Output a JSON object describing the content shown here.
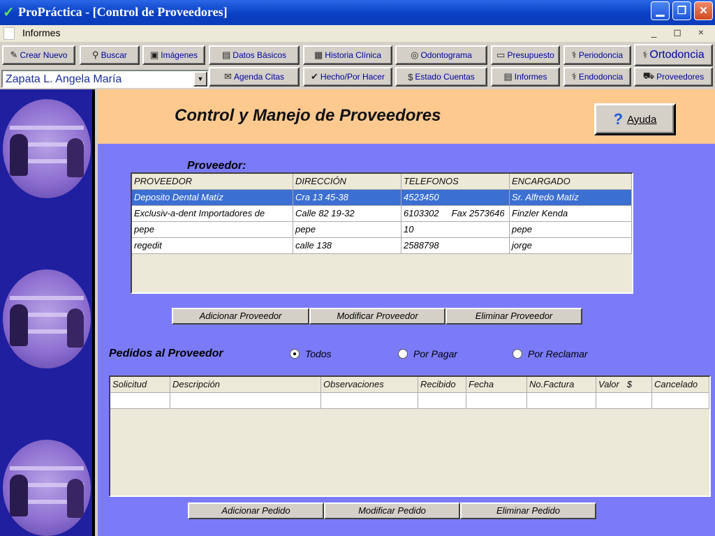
{
  "window": {
    "title": "ProPráctica - [Control de Proveedores]",
    "check_glyph": "✓"
  },
  "menubar": {
    "items": [
      "Informes"
    ],
    "mdi_controls": "_ ◻ ×"
  },
  "toolbar": {
    "buttons": [
      {
        "label": "Crear Nuevo",
        "icon": "✎"
      },
      {
        "label": "Buscar",
        "icon": "⚲"
      },
      {
        "label": "Imágenes",
        "icon": "▣"
      },
      {
        "label": "Datos Básicos",
        "icon": "▤"
      },
      {
        "label": "Historia Clínica",
        "icon": "▦"
      },
      {
        "label": "Odontograma",
        "icon": "◎"
      },
      {
        "label": "Presupuesto",
        "icon": "▭"
      },
      {
        "label": "Periodoncia",
        "icon": "⚕"
      },
      {
        "label": "Ortodoncia",
        "icon": "⚕"
      },
      {
        "label": "Agenda Citas",
        "icon": "✉"
      },
      {
        "label": "Hecho/Por Hacer",
        "icon": "✔"
      },
      {
        "label": "Estado Cuentas",
        "icon": "$"
      },
      {
        "label": "Informes",
        "icon": "▤"
      },
      {
        "label": "Endodoncia",
        "icon": "⚕"
      },
      {
        "label": "Proveedores",
        "icon": "⛟"
      }
    ],
    "patient": "Zapata L. Angela María"
  },
  "header": {
    "title": "Control y Manejo de Proveedores",
    "help_label": "Ayuda",
    "help_icon": "?"
  },
  "providers": {
    "label": "Proveedor:",
    "columns": [
      "PROVEEDOR",
      "DIRECCIÓN",
      "TELEFONOS",
      "ENCARGADO"
    ],
    "rows": [
      [
        "Deposito Dental Matíz",
        "Cra 13 45-38",
        "4523450",
        "Sr. Alfredo Matíz"
      ],
      [
        "Exclusiv-a-dent Importadores de",
        "Calle 82 19-32",
        "6103302     Fax 2573646",
        "Finzler Kenda"
      ],
      [
        "pepe",
        "pepe",
        "10",
        "pepe"
      ],
      [
        "regedit",
        "calle 138",
        "2588798",
        "jorge"
      ]
    ],
    "buttons": [
      "Adicionar Proveedor",
      "Modificar Proveedor",
      "Eliminar Proveedor"
    ]
  },
  "orders": {
    "label": "Pedidos al Proveedor",
    "filters": [
      "Todos",
      "Por Pagar",
      "Por Reclamar"
    ],
    "selected_filter": "Todos",
    "columns": [
      "Solicitud",
      "Descripción",
      "Observaciones",
      "Recibido",
      "Fecha",
      "No.Factura",
      "Valor   $",
      "Cancelado"
    ],
    "buttons": [
      "Adicionar Pedido",
      "Modificar Pedido",
      "Eliminar Pedido"
    ]
  }
}
